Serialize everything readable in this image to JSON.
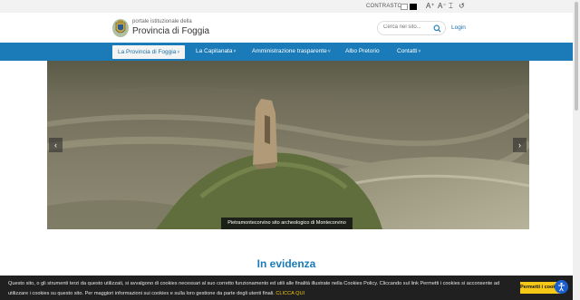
{
  "topbar": {
    "contrast_label": "CONTRASTO:",
    "tools": [
      {
        "glyph": "A⁺",
        "icon": "font-increase-icon"
      },
      {
        "glyph": "A⁻",
        "icon": "font-decrease-icon"
      },
      {
        "glyph": "⌶",
        "icon": "line-height-icon"
      },
      {
        "glyph": "↺",
        "icon": "reset-icon"
      }
    ]
  },
  "header": {
    "logo_small": "portale istituzionale della",
    "logo_big": "Provincia di Foggia",
    "search_placeholder": "Cerca nel sito...",
    "login": "Login"
  },
  "nav": {
    "items": [
      {
        "label": "La Provincia di Foggia",
        "caret": "˅"
      },
      {
        "label": "La Capitanata",
        "caret": "˅"
      },
      {
        "label": "Amministrazione trasparente",
        "caret": "˅"
      },
      {
        "label": "Albo Pretorio",
        "caret": ""
      },
      {
        "label": "Contatti",
        "caret": "˅"
      }
    ]
  },
  "hero": {
    "caption": "Pietramontecorvino sito archeologico di Montecorvino",
    "prev": "‹",
    "next": "›"
  },
  "section": {
    "title": "In evidenza"
  },
  "cookie": {
    "text": "Questo sito, o gli strumenti terzi da questo utilizzati, si avvalgono di cookies necessari al suo corretto funzionamento ed utili alle finalità illustrate nella Cookies Policy. Cliccando sul link Permetti i cookies si acconsente ad utilizzare i cookies su questo sito. Per maggiori informazioni sui cookies e sulla loro gestione da parte degli utenti finali.",
    "link": "CLICCA QUI",
    "button": "Permetti i cookies"
  },
  "colors": {
    "nav_blue": "#1a7bb8",
    "cookie_button": "#f6c917",
    "accessibility_blue": "#1a5fd0"
  }
}
